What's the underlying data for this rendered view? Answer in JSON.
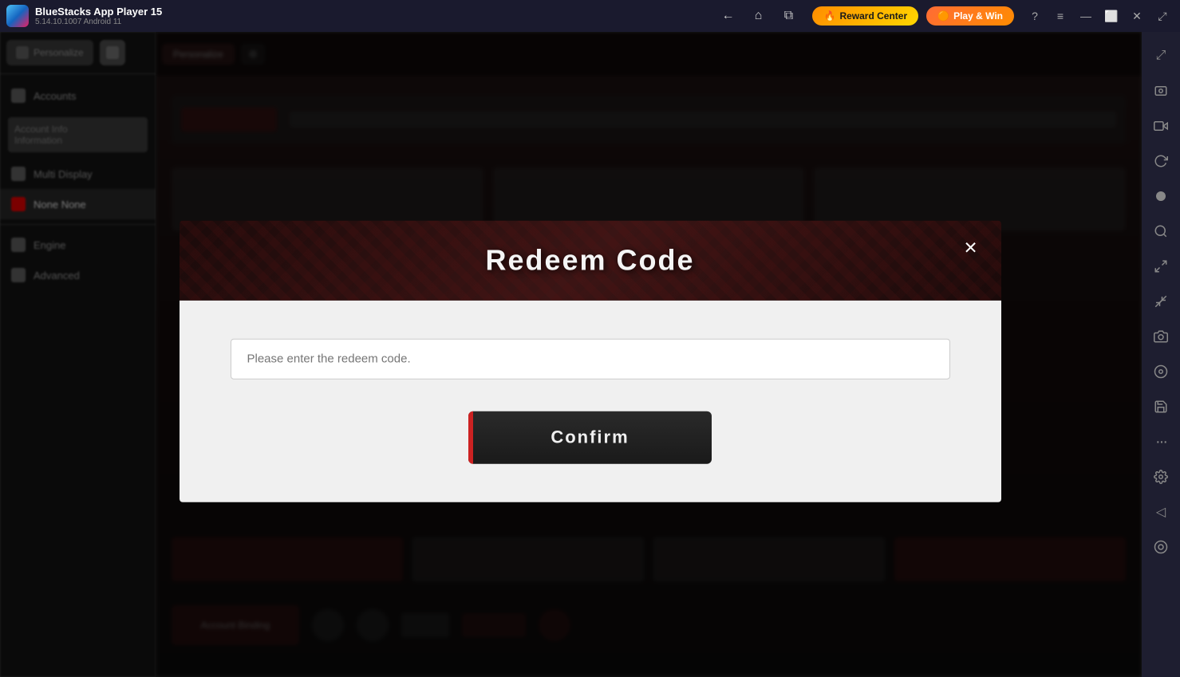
{
  "titlebar": {
    "logo_alt": "BlueStacks logo",
    "app_name": "BlueStacks App Player 15",
    "app_version": "5.14.10.1007  Android 11",
    "nav": {
      "back_label": "←",
      "home_label": "⌂",
      "multi_label": "⧉"
    },
    "reward_center_label": "Reward Center",
    "play_win_label": "Play & Win",
    "help_label": "?",
    "menu_label": "≡",
    "minimize_label": "—",
    "maximize_label": "⬜",
    "close_label": "✕",
    "expand_label": "⤢"
  },
  "sidebar_right": {
    "icons": [
      {
        "name": "expand-icon",
        "symbol": "⤢"
      },
      {
        "name": "screenshot-icon",
        "symbol": "📷"
      },
      {
        "name": "camera-icon",
        "symbol": "🎥"
      },
      {
        "name": "refresh-icon",
        "symbol": "↺"
      },
      {
        "name": "record-icon",
        "symbol": "⏺"
      },
      {
        "name": "zoom-icon",
        "symbol": "🔍"
      },
      {
        "name": "resize-icon",
        "symbol": "⤡"
      },
      {
        "name": "resize2-icon",
        "symbol": "⤢"
      },
      {
        "name": "crop-icon",
        "symbol": "✂"
      },
      {
        "name": "gyro-icon",
        "symbol": "⊕"
      },
      {
        "name": "save-icon",
        "symbol": "💾"
      },
      {
        "name": "more-icon",
        "symbol": "···"
      },
      {
        "name": "settings-icon",
        "symbol": "⚙"
      },
      {
        "name": "collapse-icon",
        "symbol": "◁"
      },
      {
        "name": "virtual-icon",
        "symbol": "◎"
      }
    ]
  },
  "modal": {
    "title": "Redeem Code",
    "close_label": "×",
    "input_placeholder": "Please enter the redeem code.",
    "confirm_label": "Confirm"
  }
}
